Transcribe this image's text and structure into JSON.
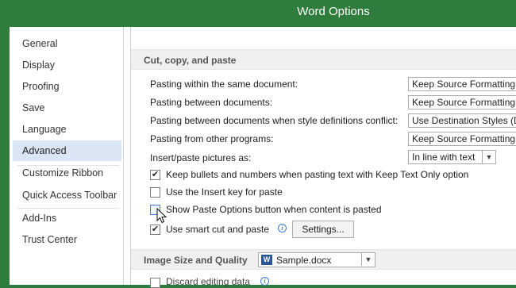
{
  "window": {
    "title": "Word Options"
  },
  "sidebar": {
    "items": [
      {
        "label": "General"
      },
      {
        "label": "Display"
      },
      {
        "label": "Proofing"
      },
      {
        "label": "Save"
      },
      {
        "label": "Language"
      },
      {
        "label": "Advanced",
        "selected": true
      },
      {
        "label": "Customize Ribbon"
      },
      {
        "label": "Quick Access Toolbar"
      },
      {
        "label": "Add-Ins"
      },
      {
        "label": "Trust Center"
      }
    ]
  },
  "cut_copy_paste": {
    "title": "Cut, copy, and paste",
    "rows": [
      {
        "label": "Pasting within the same document:",
        "value": "Keep Source Formatting (Default)"
      },
      {
        "label": "Pasting between documents:",
        "value": "Keep Source Formatting (Default)"
      },
      {
        "label": "Pasting between documents when style definitions conflict:",
        "value": "Use Destination Styles (Default)"
      },
      {
        "label": "Pasting from other programs:",
        "value": "Keep Source Formatting (Default)"
      },
      {
        "label": "Insert/paste pictures as:",
        "value": "In line with text"
      }
    ],
    "checkboxes": [
      {
        "label": "Keep bullets and numbers when pasting text with Keep Text Only option",
        "checked": true
      },
      {
        "label": "Use the Insert key for paste",
        "checked": false
      },
      {
        "label": "Show Paste Options button when content is pasted",
        "checked": false
      },
      {
        "label": "Use smart cut and paste",
        "checked": true
      }
    ],
    "settings_button": "Settings..."
  },
  "image_size_quality": {
    "title": "Image Size and Quality",
    "document": "Sample.docx",
    "partial_checkbox": "Discard editing data"
  },
  "icons": {
    "info": "info-icon",
    "dropdown": "chevron-down-icon",
    "word": "word-document-icon",
    "cursor": "mouse-pointer-icon"
  },
  "colors": {
    "titlebar": "#2e7d3c",
    "selected_nav": "#dbe6f4",
    "section_header": "#f0f0f0"
  }
}
